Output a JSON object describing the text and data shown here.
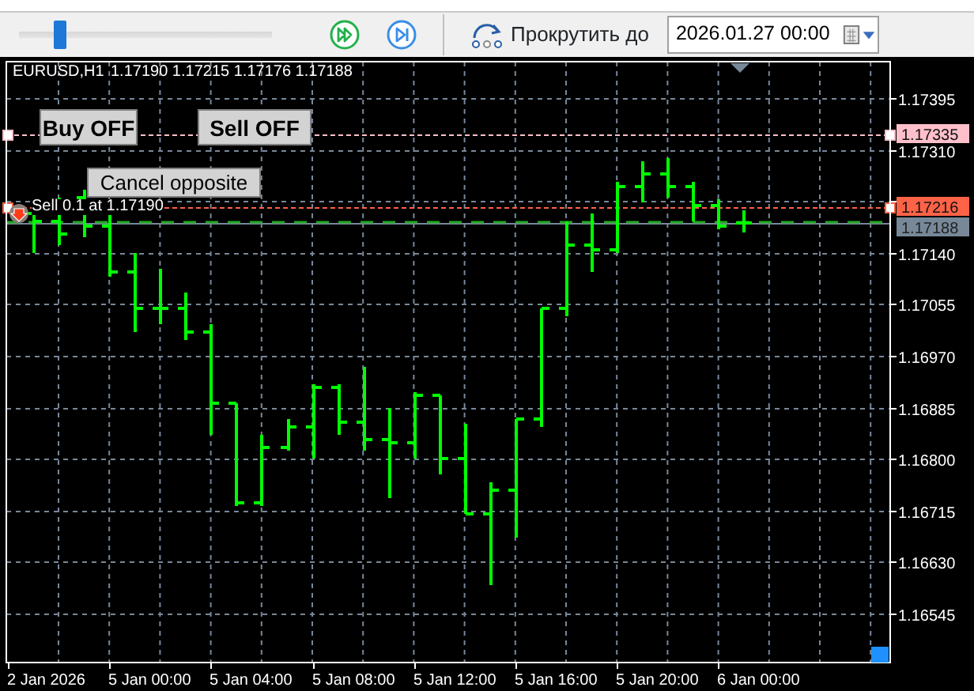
{
  "toolbar": {
    "slider": {
      "level": 0.16
    },
    "scroll_label": "Прокрутить до",
    "date_field": {
      "value": "2026.01.27 00:00"
    }
  },
  "chart": {
    "symbol": "EURUSD,H1",
    "ohlc": [
      "1.17190",
      "1.17215",
      "1.17176",
      "1.17188"
    ],
    "buttons": [
      {
        "label": "Buy OFF",
        "kind": "toggle"
      },
      {
        "label": "Sell OFF",
        "kind": "toggle"
      },
      {
        "label": "Cancel opposite",
        "kind": "action"
      }
    ],
    "position": {
      "text": "Sell 0.1 at 1.17190"
    },
    "levels": [
      {
        "label": "1.17335",
        "color": "#ffc0cb",
        "kind": "order"
      },
      {
        "label": "1.17216",
        "color": "#ff6347",
        "kind": "order"
      },
      {
        "label": "1.17188",
        "color": "#778899",
        "kind": "bid"
      }
    ],
    "price_axis": [
      "1.17395",
      "1.17310",
      "1.17140",
      "1.17055",
      "1.16970",
      "1.16885",
      "1.16800",
      "1.16715",
      "1.16630",
      "1.16545"
    ],
    "time_axis": [
      "2 Jan 2026",
      "5 Jan 00:00",
      "5 Jan 04:00",
      "5 Jan 08:00",
      "5 Jan 12:00",
      "5 Jan 16:00",
      "5 Jan 20:00",
      "6 Jan 00:00"
    ]
  }
}
